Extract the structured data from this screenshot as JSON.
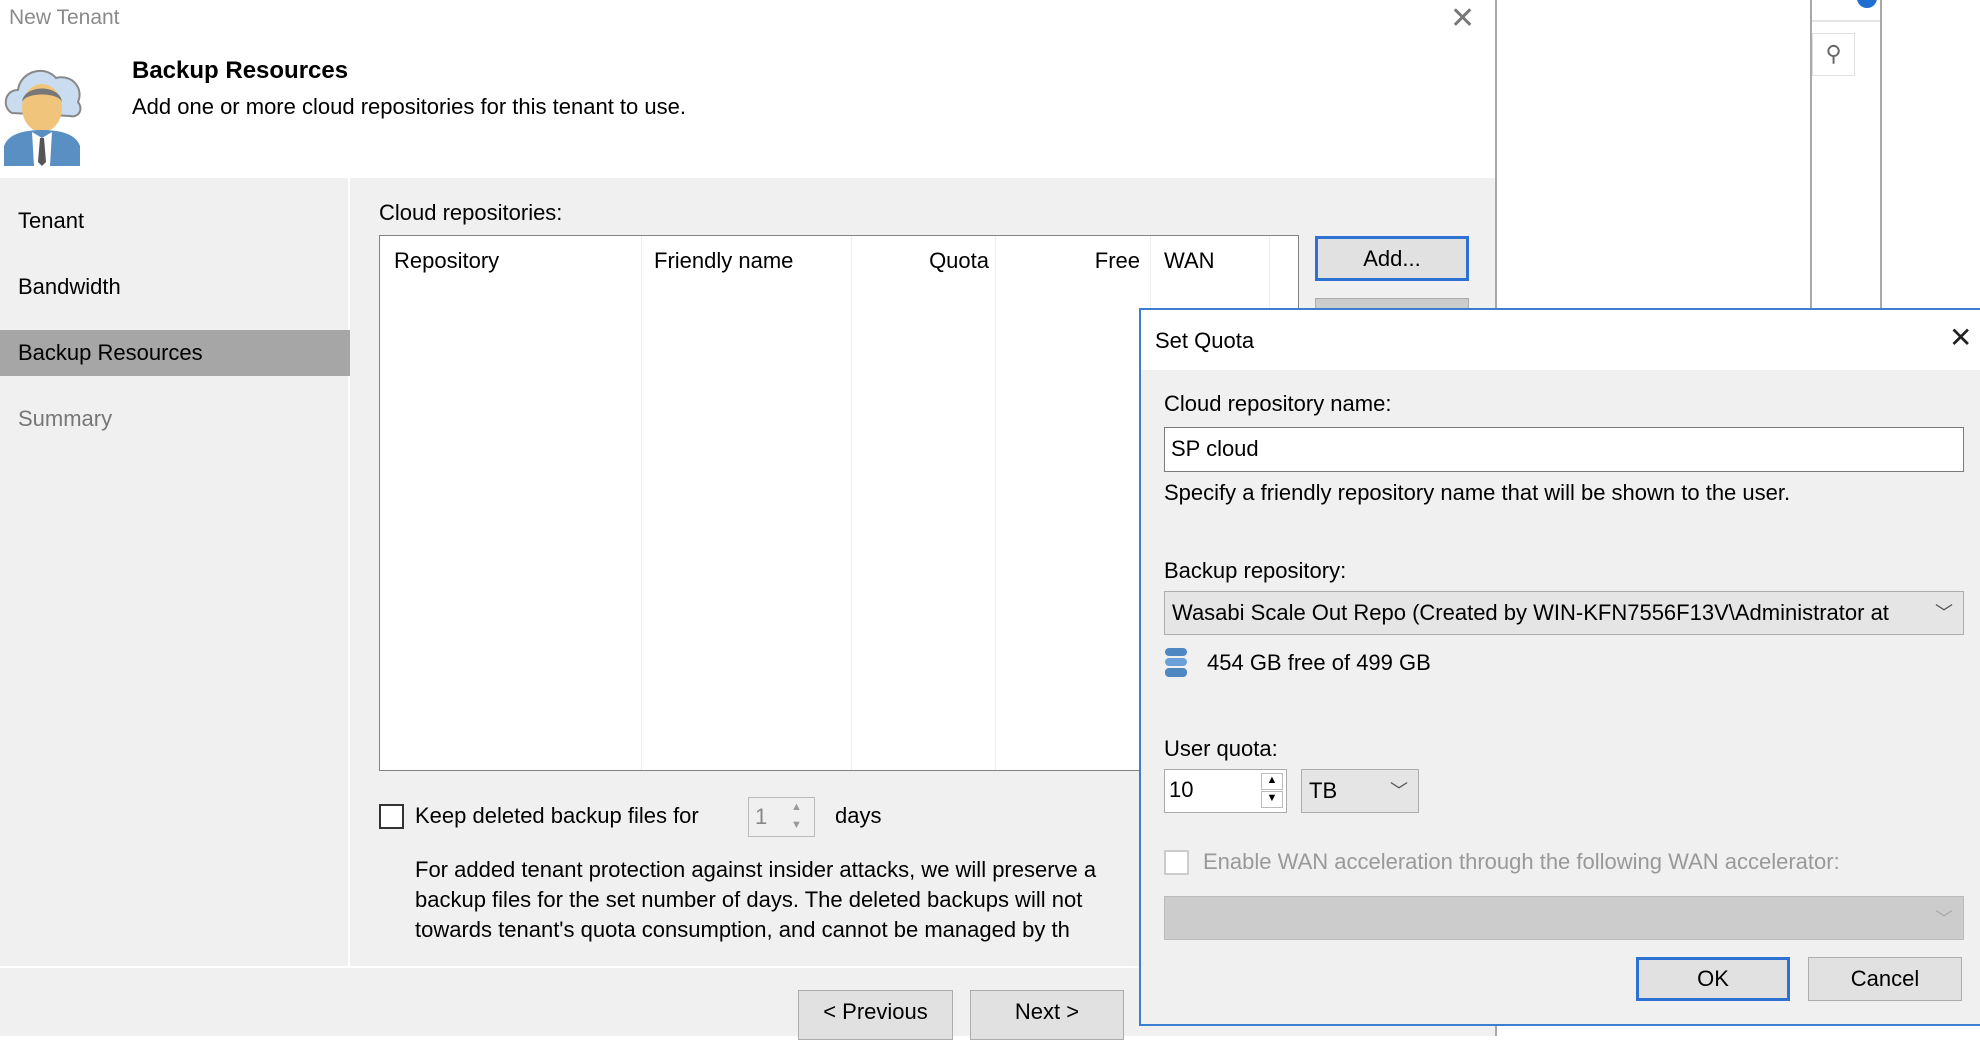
{
  "wizard": {
    "title": "New Tenant",
    "header_title": "Backup Resources",
    "header_subtitle": "Add one or more cloud repositories for this tenant to use.",
    "nav": [
      {
        "label": "Tenant",
        "state": "done"
      },
      {
        "label": "Bandwidth",
        "state": "done"
      },
      {
        "label": "Backup Resources",
        "state": "selected"
      },
      {
        "label": "Summary",
        "state": "pending"
      }
    ],
    "repos_label": "Cloud repositories:",
    "columns": [
      "Repository",
      "Friendly name",
      "Quota",
      "Free",
      "WAN"
    ],
    "rows": [],
    "add_button": "Add...",
    "keep_deleted_label": "Keep deleted backup files for",
    "keep_deleted_checked": false,
    "keep_days_value": "1",
    "days_label": "days",
    "protection_text": [
      "For added tenant protection against insider attacks, we will preserve a",
      "backup files for the set number of days. The deleted backups will not",
      "towards tenant's quota consumption, and cannot be managed by th"
    ],
    "previous_button": "< Previous",
    "next_button": "Next >"
  },
  "set_quota": {
    "title": "Set Quota",
    "name_label": "Cloud repository name:",
    "name_value": "SP cloud",
    "name_hint": "Specify a friendly repository name that will be shown to the user.",
    "repo_label": "Backup repository:",
    "repo_value": "Wasabi Scale Out Repo (Created by WIN-KFN7556F13V\\Administrator at",
    "free_space": "454 GB free of 499 GB",
    "quota_label": "User quota:",
    "quota_value": "10",
    "quota_unit": "TB",
    "wan_label": "Enable WAN acceleration through the following WAN accelerator:",
    "wan_checked": false,
    "wan_value": "",
    "ok_button": "OK",
    "cancel_button": "Cancel"
  },
  "colors": {
    "accent": "#2d72d2",
    "selected_nav": "#a6a6a6",
    "dialog_border": "#3c7fd1"
  }
}
